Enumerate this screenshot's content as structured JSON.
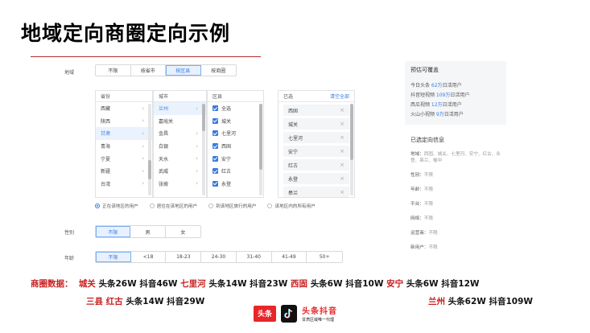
{
  "title": "地域定向商圈定向示例",
  "form": {
    "region_label": "地域",
    "region_tabs": [
      "不限",
      "按省市",
      "按区县",
      "按商圈"
    ],
    "province_header": "省份",
    "provinces": [
      "西藏",
      "陕西",
      "甘肃",
      "青海",
      "宁夏",
      "新疆",
      "台湾"
    ],
    "city_header": "城市",
    "cities": [
      "兰州",
      "嘉峪关",
      "金昌",
      "白银",
      "天水",
      "武威",
      "张掖"
    ],
    "county_header": "区县",
    "counties": [
      "全选",
      "城关",
      "七里河",
      "西固",
      "安宁",
      "红古",
      "永登"
    ],
    "selected_header": "已选",
    "clear_all": "清空全部",
    "selected": [
      "西固",
      "城关",
      "七里河",
      "安宁",
      "红古",
      "永登",
      "皋兰"
    ],
    "radio_options": [
      "正在该地区的用户",
      "居住在该地区的用户",
      "到该地区旅行的用户",
      "该地区内的所有用户"
    ],
    "gender_label": "性别",
    "gender_options": [
      "不限",
      "男",
      "女"
    ],
    "age_label": "年龄",
    "age_options": [
      "不限",
      "<18",
      "18-23",
      "24-30",
      "31-40",
      "41-49",
      "50+"
    ]
  },
  "side": {
    "coverage_title": "预估可覆盖",
    "coverage": [
      {
        "pre": "今日头条 ",
        "num": "62万",
        "post": "日活用户"
      },
      {
        "pre": "抖音短视频 ",
        "num": "109万",
        "post": "日活用户"
      },
      {
        "pre": "西瓜视频 ",
        "num": "12万",
        "post": "日活用户"
      },
      {
        "pre": "火山小视频 ",
        "num": "9万",
        "post": "日活用户"
      }
    ],
    "info_title": "已选定向信息",
    "info": [
      {
        "k": "地域：",
        "v": "西固、城关、七里河、安宁、红古、永登、皋兰、榆中"
      },
      {
        "k": "性别：",
        "v": "不限"
      },
      {
        "k": "年龄：",
        "v": "不限"
      },
      {
        "k": "平台：",
        "v": "不限"
      },
      {
        "k": "网络：",
        "v": "不限"
      },
      {
        "k": "运营商：",
        "v": "不限"
      },
      {
        "k": "新用户：",
        "v": "不限"
      }
    ]
  },
  "stats": {
    "label": "商圈数据：",
    "line1": [
      {
        "place": "城关",
        "data": "头条26W 抖音46W"
      },
      {
        "place": "七里河",
        "data": "头条14W 抖音23W"
      },
      {
        "place": "西固",
        "data": "头条6W 抖音10W"
      },
      {
        "place": "安宁",
        "data": "头条6W 抖音12W"
      }
    ],
    "line2a_place1": "三县",
    "line2a_place2": "红古",
    "line2a_data": "头条14W 抖音29W",
    "line2b_place": "兰州",
    "line2b_data": "头条62W 抖音109W"
  },
  "footer": {
    "toutiao": "头条",
    "brand": "头条抖音",
    "slogan": "甘肃区域唯一代理"
  },
  "colors": {
    "accent": "#3a7be0",
    "red": "#c81f1f"
  }
}
